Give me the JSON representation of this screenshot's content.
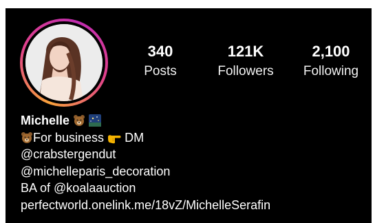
{
  "profile": {
    "stats": {
      "posts": {
        "value": "340",
        "label": "Posts"
      },
      "followers": {
        "value": "121K",
        "label": "Followers"
      },
      "following": {
        "value": "2,100",
        "label": "Following"
      }
    },
    "name": "Michelle",
    "bio": {
      "business_prefix": "For business",
      "business_suffix": "DM",
      "lines": [
        "@crabstergendut",
        "@michelleparis_decoration",
        "BA of @koalaauction",
        "perfectworld.onelink.me/18vZ/MichelleSerafin"
      ]
    },
    "icons": {
      "bear": "bear-emoji-icon",
      "night_sky": "night-sky-emoji-icon",
      "pointing_hand": "pointing-hand-emoji-icon"
    },
    "colors": {
      "background": "#000000",
      "text": "#ffffff",
      "story_ring_start": "#f9a23b",
      "story_ring_end": "#c02cb0"
    }
  }
}
